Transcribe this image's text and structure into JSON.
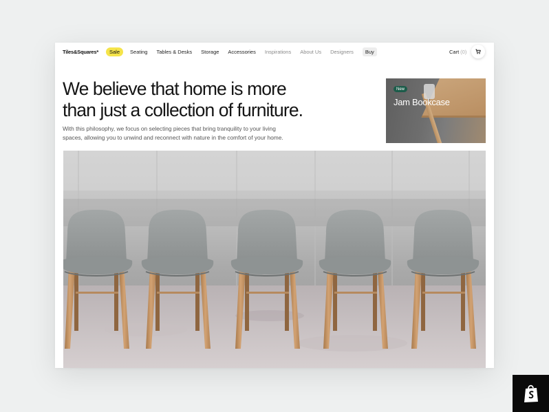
{
  "brand": {
    "logo": "Tiles&Squares*"
  },
  "nav": {
    "items": [
      {
        "label": "Sale"
      },
      {
        "label": "Seating"
      },
      {
        "label": "Tables & Desks"
      },
      {
        "label": "Storage"
      },
      {
        "label": "Accessories"
      },
      {
        "label": "Inspirations"
      },
      {
        "label": "About Us"
      },
      {
        "label": "Designers"
      },
      {
        "label": "Buy"
      }
    ],
    "cart_label": "Cart",
    "cart_count": "(0)"
  },
  "hero": {
    "headline_line1": "We believe that home is more",
    "headline_line2": "than just a collection of furniture.",
    "subtext_line1": "With this philosophy, we focus on selecting pieces that bring tranquility to your living",
    "subtext_line2": "spaces, allowing you to unwind and reconnect with nature in the comfort of your home."
  },
  "promo": {
    "badge": "New",
    "title": "Jam Bookcase"
  },
  "colors": {
    "sale_highlight": "#f5e44a",
    "new_badge": "#1c5c4a",
    "shopify_badge": "#0a0a0a"
  },
  "icons": {
    "cart": "cart-icon",
    "shopify": "shopify-bag-icon"
  }
}
